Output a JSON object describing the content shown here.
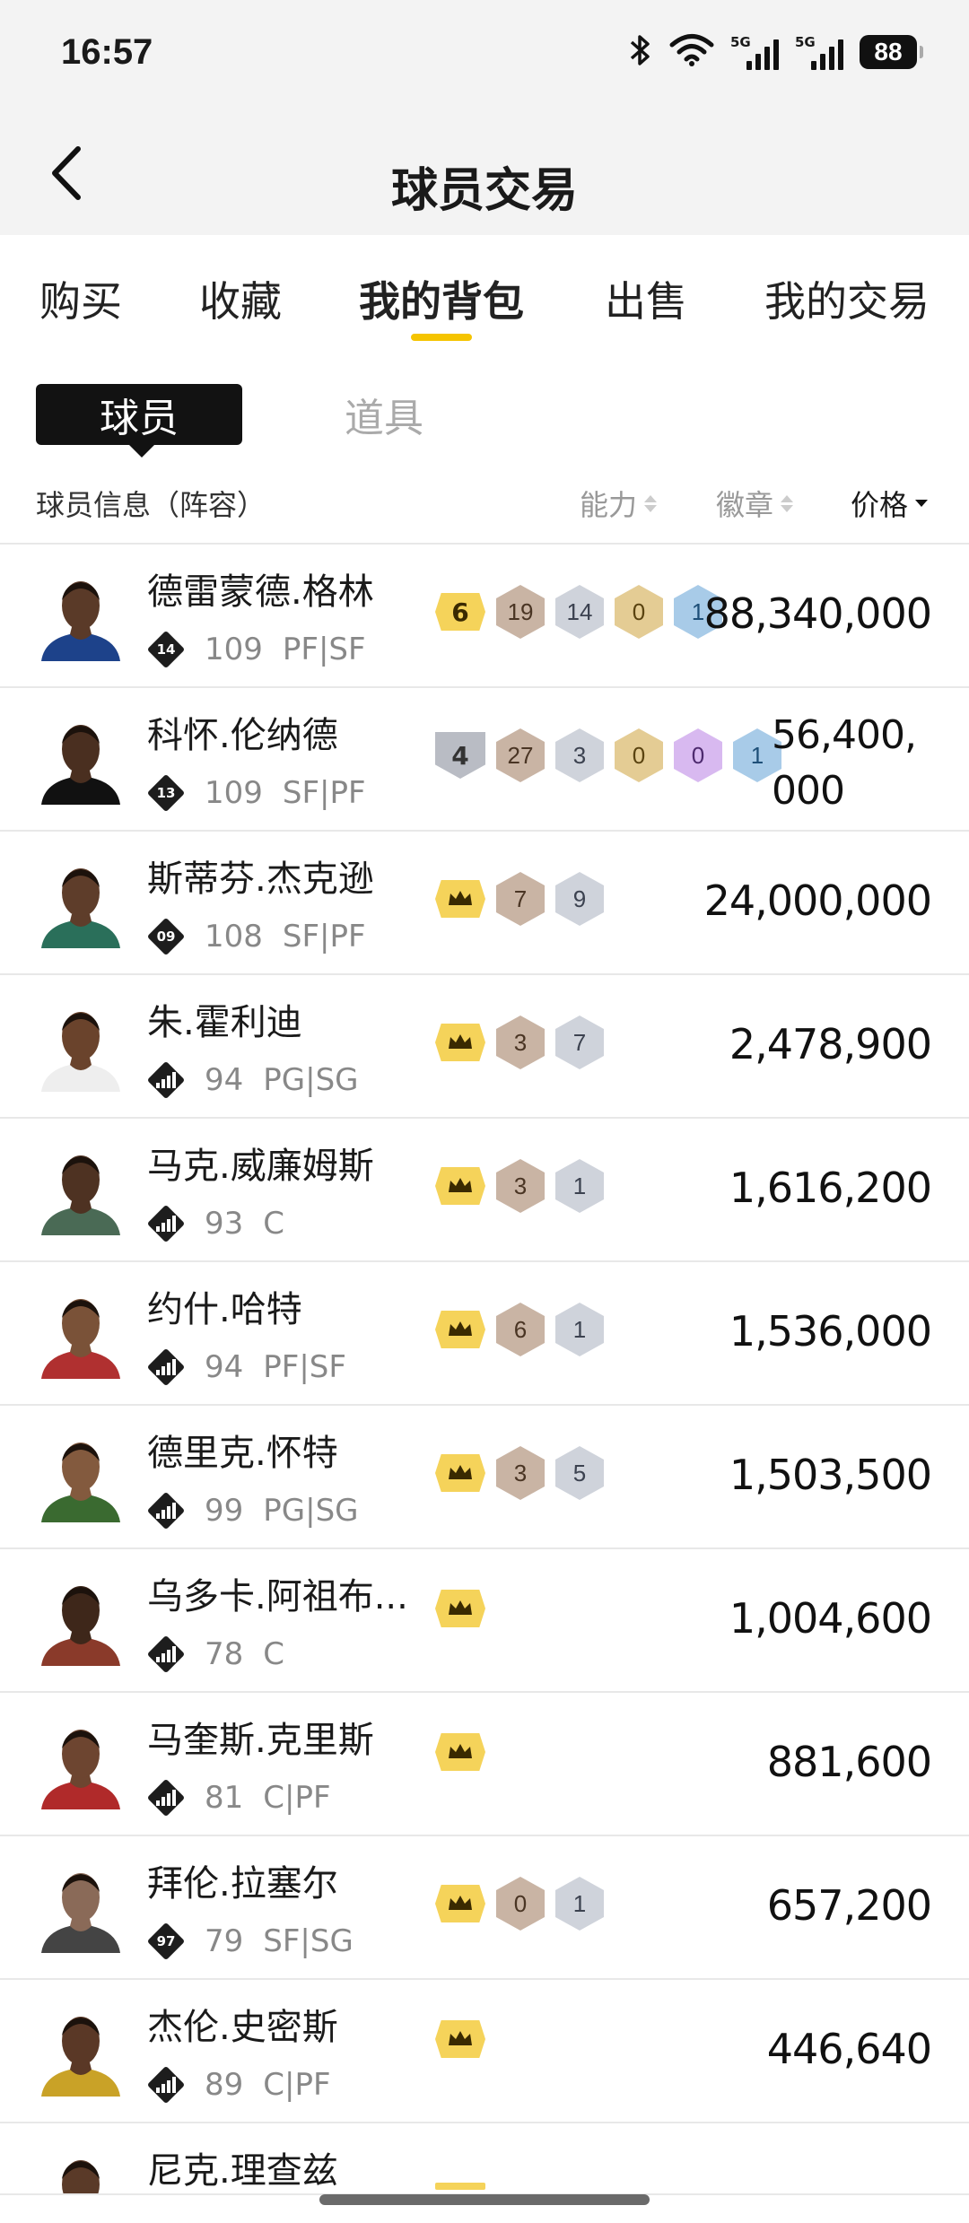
{
  "status": {
    "time": "16:57",
    "battery": "88",
    "net1": "5G",
    "net2": "5G"
  },
  "header": {
    "title": "球员交易"
  },
  "tabs": [
    {
      "label": "购买"
    },
    {
      "label": "收藏"
    },
    {
      "label": "我的背包"
    },
    {
      "label": "出售"
    },
    {
      "label": "我的交易"
    }
  ],
  "segments": {
    "active": "球员",
    "inactive": "道具"
  },
  "columns": {
    "info": "球员信息（阵容）",
    "ability": "能力",
    "badges": "徽章",
    "price": "价格"
  },
  "players": [
    {
      "name": "德雷蒙德.格林",
      "rank": "14",
      "rating": "109",
      "pos": "PF|SF",
      "level": "6",
      "badges": [
        [
          "bronze",
          "19"
        ],
        [
          "silver",
          "14"
        ],
        [
          "gold",
          "0"
        ],
        [
          "blue",
          "1"
        ]
      ],
      "price": "88,340,000"
    },
    {
      "name": "科怀.伦纳德",
      "rank": "13",
      "rating": "109",
      "pos": "SF|PF",
      "level": "4",
      "badges": [
        [
          "bronze",
          "27"
        ],
        [
          "silver",
          "3"
        ],
        [
          "gold",
          "0"
        ],
        [
          "purple",
          "0"
        ],
        [
          "blue",
          "1"
        ]
      ],
      "price": "56,400,000"
    },
    {
      "name": "斯蒂芬.杰克逊",
      "rank": "09",
      "rating": "108",
      "pos": "SF|PF",
      "level": "crown",
      "badges": [
        [
          "bronze",
          "7"
        ],
        [
          "silver",
          "9"
        ]
      ],
      "price": "24,000,000"
    },
    {
      "name": "朱.霍利迪",
      "rank": "bars",
      "rating": "94",
      "pos": "PG|SG",
      "level": "crown",
      "badges": [
        [
          "bronze",
          "3"
        ],
        [
          "silver",
          "7"
        ]
      ],
      "price": "2,478,900"
    },
    {
      "name": "马克.威廉姆斯",
      "rank": "bars",
      "rating": "93",
      "pos": "C",
      "level": "crown",
      "badges": [
        [
          "bronze",
          "3"
        ],
        [
          "silver",
          "1"
        ]
      ],
      "price": "1,616,200"
    },
    {
      "name": "约什.哈特",
      "rank": "bars",
      "rating": "94",
      "pos": "PF|SF",
      "level": "crown",
      "badges": [
        [
          "bronze",
          "6"
        ],
        [
          "silver",
          "1"
        ]
      ],
      "price": "1,536,000"
    },
    {
      "name": "德里克.怀特",
      "rank": "bars",
      "rating": "99",
      "pos": "PG|SG",
      "level": "crown",
      "badges": [
        [
          "bronze",
          "3"
        ],
        [
          "silver",
          "5"
        ]
      ],
      "price": "1,503,500"
    },
    {
      "name": "乌多卡.阿祖布...",
      "rank": "bars",
      "rating": "78",
      "pos": "C",
      "level": "crown",
      "badges": [],
      "price": "1,004,600"
    },
    {
      "name": "马奎斯.克里斯",
      "rank": "bars",
      "rating": "81",
      "pos": "C|PF",
      "level": "crown",
      "badges": [],
      "price": "881,600"
    },
    {
      "name": "拜伦.拉塞尔",
      "rank": "97",
      "rating": "79",
      "pos": "SF|SG",
      "level": "crown",
      "badges": [
        [
          "bronze",
          "0"
        ],
        [
          "silver",
          "1"
        ]
      ],
      "price": "657,200"
    },
    {
      "name": "杰伦.史密斯",
      "rank": "bars",
      "rating": "89",
      "pos": "C|PF",
      "level": "crown",
      "badges": [],
      "price": "446,640"
    }
  ],
  "partial_player": {
    "name": "尼克.理查兹"
  },
  "colors": {
    "accent": "#f5c400",
    "segment_bg": "#121212",
    "header_bg": "#f3f3f3"
  }
}
